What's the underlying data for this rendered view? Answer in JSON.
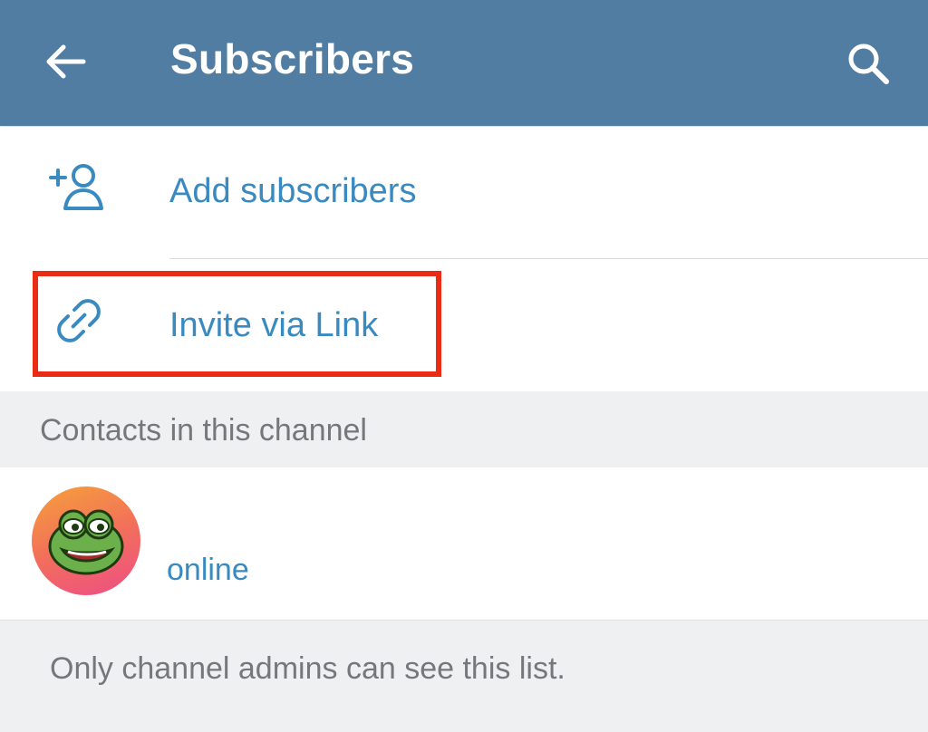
{
  "header": {
    "title": "Subscribers",
    "back_icon": "arrow-left-icon",
    "search_icon": "search-icon",
    "background_color": "#527da3"
  },
  "actions": [
    {
      "label": "Add subscribers",
      "icon": "add-user-icon"
    },
    {
      "label": "Invite via Link",
      "icon": "link-icon",
      "highlighted": true
    }
  ],
  "contacts_section": {
    "title": "Contacts in this channel",
    "contacts": [
      {
        "name": "",
        "status": "online",
        "avatar": "frog-sticker-avatar"
      }
    ]
  },
  "footer": {
    "note": "Only channel admins can see this list."
  },
  "colors": {
    "accent": "#3a8ac2",
    "highlight": "#ea2c14",
    "section_bg": "#eff0f2",
    "muted_text": "#75787b"
  }
}
